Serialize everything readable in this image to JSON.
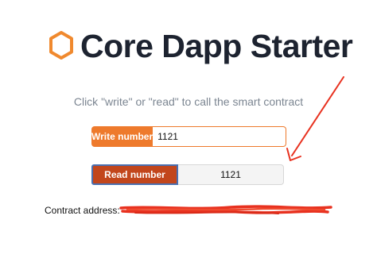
{
  "header": {
    "title": "Core Dapp Starter",
    "logo_icon": "hexagon-outline-icon",
    "logo_color": "#f0892e"
  },
  "subtitle": "Click \"write\" or \"read\" to call the smart contract",
  "write": {
    "button_label": "Write number",
    "input_value": "1121",
    "button_color": "#ee7a2c"
  },
  "read": {
    "button_label": "Read number",
    "output_value": "1121",
    "button_color": "#c2461c"
  },
  "contract": {
    "label": "Contract address:",
    "redaction_color": "#e8311f"
  },
  "annotation": {
    "arrow_color": "#e8311f"
  }
}
